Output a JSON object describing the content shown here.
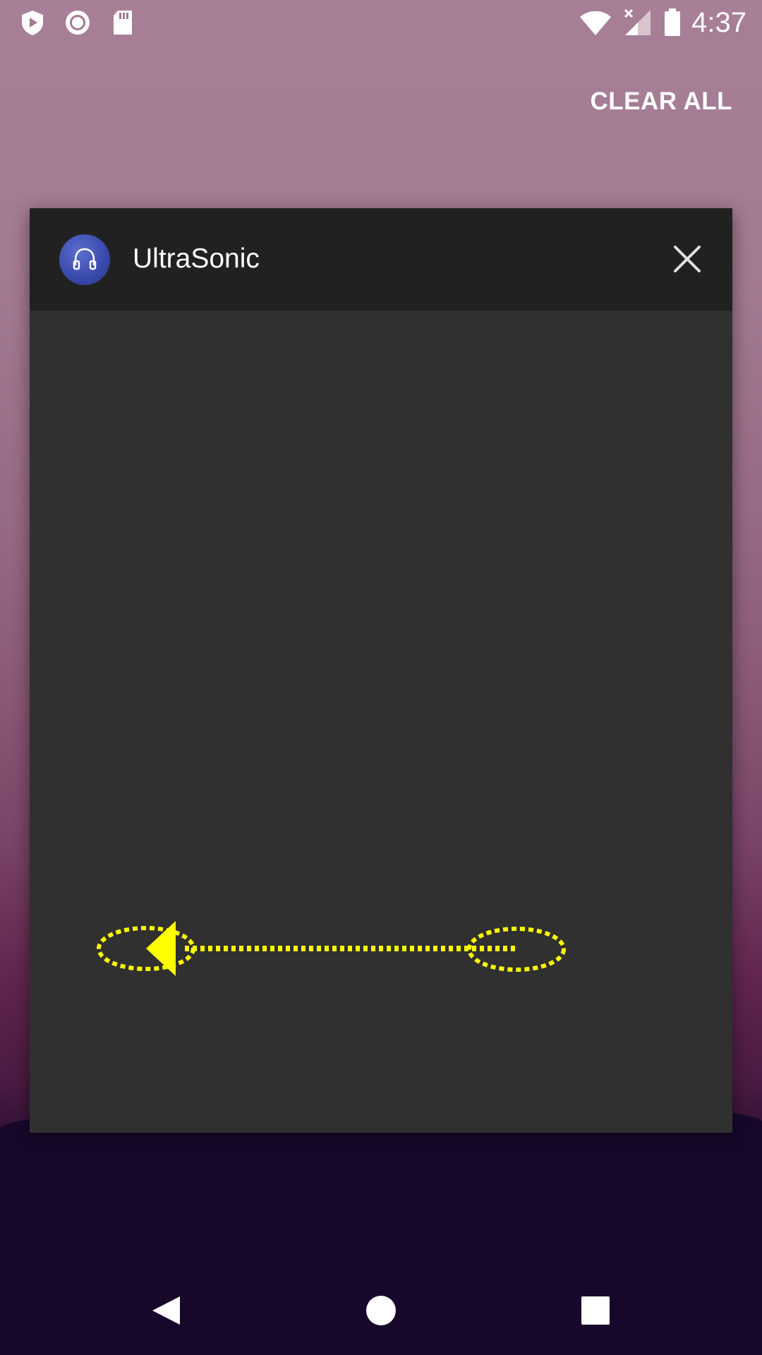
{
  "status_bar": {
    "time": "4:37",
    "left_icons": [
      "shield-play-icon",
      "record-icon",
      "sd-card-icon"
    ],
    "right_icons": [
      "wifi-icon",
      "cellular-no-signal-icon",
      "battery-icon"
    ]
  },
  "recents": {
    "clear_all_label": "CLEAR ALL"
  },
  "task_card": {
    "app_name": "UltraSonic",
    "app_icon": "headphones-icon",
    "app_icon_color": "#3949ab",
    "close_icon": "close-icon"
  },
  "gesture_overlay": {
    "type": "swipe-left",
    "color": "#ffff00"
  },
  "nav_bar": {
    "buttons": [
      "back-icon",
      "home-icon",
      "recents-icon"
    ]
  },
  "colors": {
    "card_header": "#212121",
    "card_body": "#303030",
    "accent_overlay": "#ffff00"
  }
}
